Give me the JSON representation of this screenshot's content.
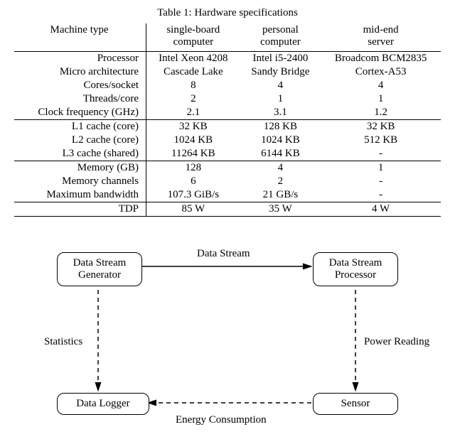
{
  "table": {
    "caption": "Table 1: Hardware specifications",
    "header_label": "Machine type",
    "columns": [
      {
        "line1": "single-board",
        "line2": "computer"
      },
      {
        "line1": "personal",
        "line2": "computer"
      },
      {
        "line1": "mid-end",
        "line2": "server"
      }
    ],
    "groups": [
      [
        {
          "label": "Processor",
          "v": [
            "Intel Xeon 4208",
            "Intel i5-2400",
            "Broadcom BCM2835"
          ]
        },
        {
          "label": "Micro architecture",
          "v": [
            "Cascade Lake",
            "Sandy Bridge",
            "Cortex-A53"
          ]
        },
        {
          "label": "Cores/socket",
          "v": [
            "8",
            "4",
            "4"
          ]
        },
        {
          "label": "Threads/core",
          "v": [
            "2",
            "1",
            "1"
          ]
        },
        {
          "label": "Clock frequency (GHz)",
          "v": [
            "2.1",
            "3.1",
            "1.2"
          ]
        }
      ],
      [
        {
          "label": "L1 cache (core)",
          "v": [
            "32 KB",
            "128 KB",
            "32 KB"
          ]
        },
        {
          "label": "L2 cache (core)",
          "v": [
            "1024 KB",
            "1024 KB",
            "512 KB"
          ]
        },
        {
          "label": "L3 cache (shared)",
          "v": [
            "11264 KB",
            "6144 KB",
            "-"
          ]
        }
      ],
      [
        {
          "label": "Memory (GB)",
          "v": [
            "128",
            "4",
            "1"
          ]
        },
        {
          "label": "Memory channels",
          "v": [
            "6",
            "2",
            "-"
          ]
        },
        {
          "label": "Maximum bandwidth",
          "v": [
            "107.3 GiB/s",
            "21 GB/s",
            "-"
          ]
        }
      ],
      [
        {
          "label": "TDP",
          "v": [
            "85 W",
            "35 W",
            "4 W"
          ]
        }
      ]
    ]
  },
  "diagram": {
    "nodes": {
      "generator": {
        "line1": "Data Stream",
        "line2": "Generator"
      },
      "processor": {
        "line1": "Data Stream",
        "line2": "Processor"
      },
      "logger": "Data Logger",
      "sensor": "Sensor"
    },
    "edge_labels": {
      "stream": "Data Stream",
      "stats": "Statistics",
      "power": "Power Reading",
      "energy": "Energy Consumption"
    }
  }
}
